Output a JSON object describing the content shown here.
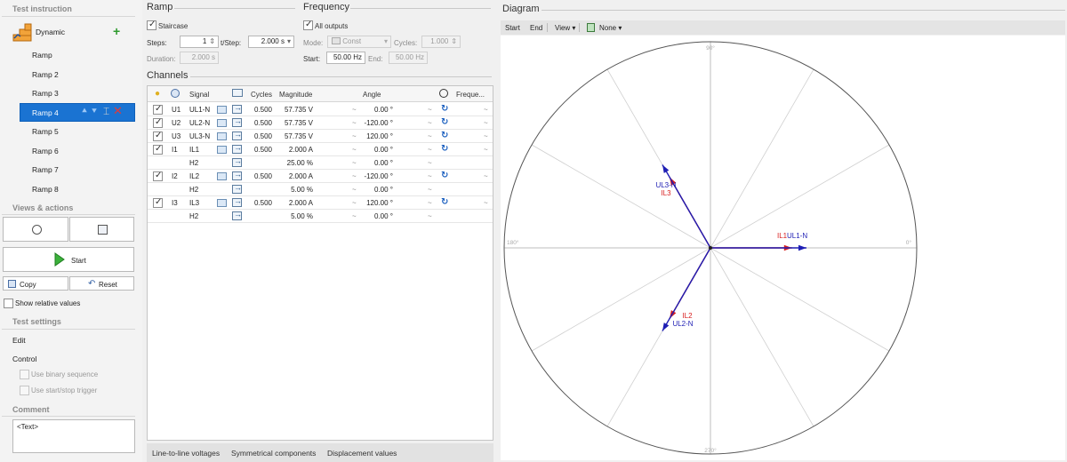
{
  "left": {
    "test_instruction": "Test instruction",
    "dynamic": "Dynamic",
    "ramps": [
      "Ramp",
      "Ramp 2",
      "Ramp 3",
      "Ramp 4",
      "Ramp 5",
      "Ramp 6",
      "Ramp 7",
      "Ramp 8"
    ],
    "views_actions": "Views & actions",
    "start": "Start",
    "copy": "Copy",
    "reset": "Reset",
    "show_relative": "Show relative values",
    "test_settings": "Test settings",
    "edit": "Edit",
    "control": "Control",
    "use_binary": "Use binary sequence",
    "use_trigger": "Use start/stop trigger",
    "comment": "Comment",
    "comment_text": "<Text>"
  },
  "ramp": {
    "title": "Ramp",
    "staircase": "Staircase",
    "steps_label": "Steps:",
    "steps_value": "1",
    "tstep_label": "t/Step:",
    "tstep_value": "2.000 s",
    "duration_label": "Duration:",
    "duration_value": "2.000 s"
  },
  "frequency": {
    "title": "Frequency",
    "all_outputs": "All outputs",
    "mode_label": "Mode:",
    "mode_value": "Const",
    "cycles_label": "Cycles:",
    "cycles_value": "1.000",
    "start_label": "Start:",
    "start_value": "50.00 Hz",
    "end_label": "End:",
    "end_value": "50.00 Hz"
  },
  "channels": {
    "title": "Channels",
    "headers": {
      "signal": "Signal",
      "cycles": "Cycles",
      "magnitude": "Magnitude",
      "angle": "Angle",
      "freq": "Freque..."
    },
    "rows": [
      {
        "check": true,
        "grp": "U1",
        "signal": "UL1-N",
        "cycles": "0.500",
        "mag": "57.735 V",
        "angle": "0.00 °",
        "rot": true
      },
      {
        "check": true,
        "grp": "U2",
        "signal": "UL2-N",
        "cycles": "0.500",
        "mag": "57.735 V",
        "angle": "-120.00 °",
        "rot": true
      },
      {
        "check": true,
        "grp": "U3",
        "signal": "UL3-N",
        "cycles": "0.500",
        "mag": "57.735 V",
        "angle": "120.00 °",
        "rot": true
      },
      {
        "check": true,
        "grp": "I1",
        "signal": "IL1",
        "cycles": "0.500",
        "mag": "2.000 A",
        "angle": "0.00 °",
        "rot": true
      },
      {
        "check": false,
        "grp": "",
        "signal": "H2",
        "cycles": "",
        "mag": "25.00 %",
        "angle": "0.00 °",
        "rot": false
      },
      {
        "check": true,
        "grp": "I2",
        "signal": "IL2",
        "cycles": "0.500",
        "mag": "2.000 A",
        "angle": "-120.00 °",
        "rot": true
      },
      {
        "check": false,
        "grp": "",
        "signal": "H2",
        "cycles": "",
        "mag": "5.00 %",
        "angle": "0.00 °",
        "rot": false
      },
      {
        "check": true,
        "grp": "I3",
        "signal": "IL3",
        "cycles": "0.500",
        "mag": "2.000 A",
        "angle": "120.00 °",
        "rot": true
      },
      {
        "check": false,
        "grp": "",
        "signal": "H2",
        "cycles": "",
        "mag": "5.00 %",
        "angle": "0.00 °",
        "rot": false
      }
    ]
  },
  "bottom_tabs": [
    "Line-to-line voltages",
    "Symmetrical components",
    "Displacement values"
  ],
  "diagram": {
    "title": "Diagram",
    "toolbar": {
      "start": "Start",
      "end": "End",
      "view": "View ▾",
      "none": "None ▾"
    },
    "angle_labels": {
      "top": "90°",
      "left": "180°",
      "right": "0°",
      "bottom": "270°"
    },
    "phasors": [
      {
        "label": "IL1",
        "label2": "UL1-N",
        "angle_deg": 0,
        "v_len": 1.0,
        "i_len": 0.85
      },
      {
        "label": "UL3-N",
        "label2": "IL3",
        "angle_deg": 120,
        "v_len": 1.0,
        "i_len": 0.85
      },
      {
        "label": "IL2",
        "label2": "UL2-N",
        "angle_deg": -120,
        "v_len": 1.0,
        "i_len": 0.85
      }
    ],
    "colors": {
      "voltage": "#1e1eb4",
      "current": "#d81e1e",
      "grid": "#cfcfcf",
      "circle": "#555555"
    }
  }
}
